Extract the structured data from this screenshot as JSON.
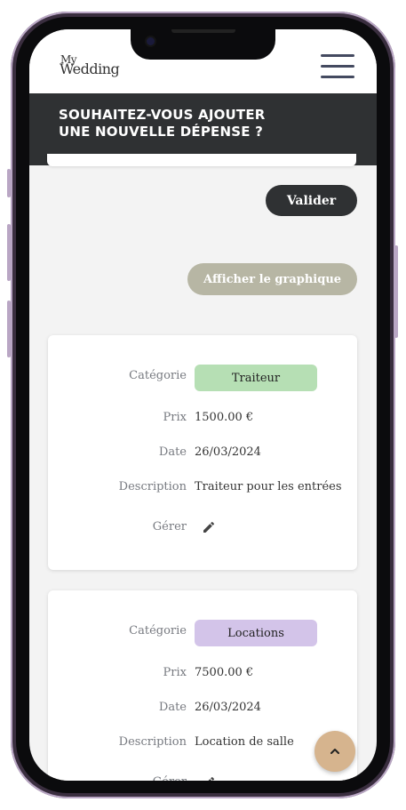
{
  "header": {
    "logo_top": "My",
    "logo_bottom": "Wedding"
  },
  "banner": {
    "text": "SOUHAITEZ-VOUS AJOUTER\nUNE NOUVELLE DÉPENSE ?"
  },
  "form": {
    "submit_label": "Valider"
  },
  "graph_button_label": "Afficher le graphique",
  "labels": {
    "category": "Catégorie",
    "price": "Prix",
    "date": "Date",
    "description": "Description",
    "manage": "Gérer"
  },
  "expenses": [
    {
      "category": "Traiteur",
      "category_color": "#b6dfb4",
      "price": "1500.00 €",
      "date": "26/03/2024",
      "description": "Traiteur pour les entrées"
    },
    {
      "category": "Locations",
      "category_color": "#d3c4e9",
      "price": "7500.00 €",
      "date": "26/03/2024",
      "description": "Location de salle"
    }
  ],
  "colors": {
    "dark": "#2f3133",
    "graph_button": "#b7b6a4",
    "scroll_button": "#d6b48e"
  },
  "icons": {
    "menu": "hamburger-icon",
    "edit": "pencil-icon",
    "scroll_top": "chevron-up-icon"
  }
}
